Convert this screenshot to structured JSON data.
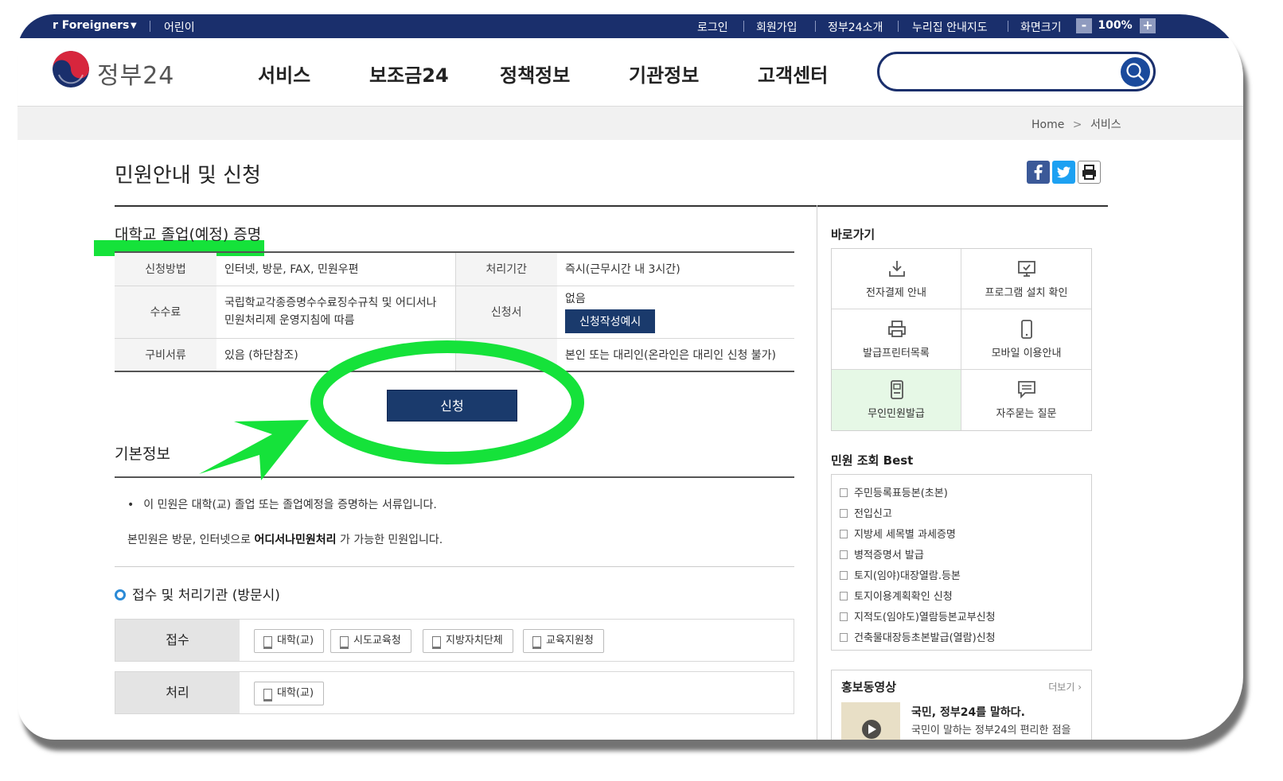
{
  "util_bar": {
    "foreigners": "r Foreigners",
    "kids": "어린이",
    "login": "로그인",
    "signup": "회원가입",
    "about": "정부24소개",
    "sitemap": "누리집 안내지도",
    "screen_size": "화면크기",
    "zoom_minus": "-",
    "zoom_value": "100%",
    "zoom_plus": "+"
  },
  "header": {
    "logo_text": "정부24",
    "nav": [
      "서비스",
      "보조금24",
      "정책정보",
      "기관정보",
      "고객센터"
    ],
    "search_value": ""
  },
  "breadcrumb": {
    "home": "Home",
    "separator": ">",
    "current": "서비스"
  },
  "page": {
    "title": "민원안내 및 신청"
  },
  "service": {
    "title": "대학교 졸업(예정) 증명",
    "rows": [
      {
        "k1": "신청방법",
        "v1": "인터넷, 방문, FAX, 민원우편",
        "k2": "처리기간",
        "v2": "즉시(근무시간 내 3시간)"
      },
      {
        "k1": "수수료",
        "v1": "국립학교각종증명수수료징수규칙 및 어디서나 민원처리제 운영지침에 따름",
        "k2": "신청서",
        "v2": "없음",
        "v2_button": "신청작성예시"
      },
      {
        "k1": "구비서류",
        "v1": "있음 (하단참조)",
        "k2": "",
        "v2": "본인 또는 대리인(온라인은 대리인 신청 불가)"
      }
    ],
    "apply_button": "신청"
  },
  "basic_info": {
    "title": "기본정보",
    "bullet": "이 민원은 대학(교) 졸업 또는 졸업예정을 증명하는 서류입니다.",
    "line2_prefix": "본민원은 방문, 인터넷으로",
    "line2_bold": "어디서나민원처리",
    "line2_suffix": "가 가능한 민원입니다."
  },
  "processing": {
    "title": "접수 및 처리기관 (방문시)",
    "receive_label": "접수",
    "receive_orgs": [
      "대학(교)",
      "시도교육청",
      "지방자치단체",
      "교육지원청"
    ],
    "process_label": "처리",
    "process_orgs": [
      "대학(교)"
    ]
  },
  "sidebar": {
    "shortcut_title": "바로가기",
    "shortcuts": [
      {
        "label": "전자결제 안내",
        "icon": "download-icon"
      },
      {
        "label": "프로그램 설치 확인",
        "icon": "monitor-check-icon"
      },
      {
        "label": "발급프린터목록",
        "icon": "printer-icon"
      },
      {
        "label": "모바일 이용안내",
        "icon": "mobile-icon"
      },
      {
        "label": "무인민원발급",
        "icon": "kiosk-icon"
      },
      {
        "label": "자주묻는 질문",
        "icon": "speech-bubble-icon"
      }
    ],
    "best_title": "민원 조회 Best",
    "best_items": [
      "주민등록표등본(초본)",
      "전입신고",
      "지방세 세목별 과세증명",
      "병적증명서 발급",
      "토지(임야)대장열람.등본",
      "토지이용계획확인 신청",
      "지적도(임야도)열람등본교부신청",
      "건축물대장등초본발급(열람)신청"
    ],
    "promo_title": "홍보동영상",
    "promo_more": "더보기 ›",
    "promo_headline": "국민, 정부24를 말하다.",
    "promo_sub": "국민이 말하는 정부24의 편리한 점을"
  },
  "colors": {
    "brand_navy": "#1a2f6c",
    "button_navy": "#1a3a6c",
    "annotation_green": "#15e23a"
  }
}
